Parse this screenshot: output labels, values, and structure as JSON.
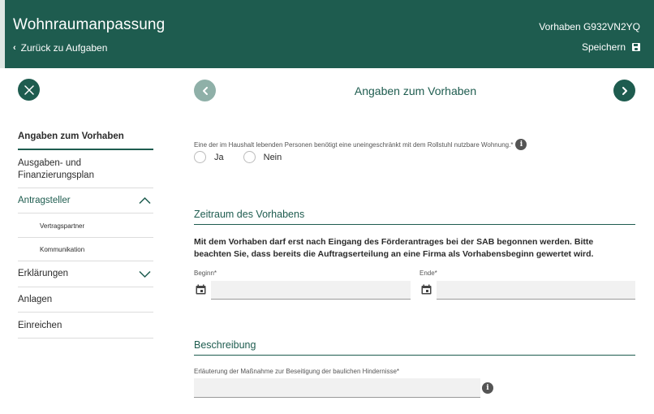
{
  "header": {
    "title": "Wohnraumanpassung",
    "back_label": "Zurück zu Aufgaben",
    "vorhaben_id": "Vorhaben G932VN2YQ",
    "save_label": "Speichern"
  },
  "colors": {
    "primary": "#1e5c4f",
    "primary_disabled": "#8fb0a8",
    "input_bg": "#f1f1f1"
  },
  "page": {
    "section_heading": "Angaben zum Vorhaben"
  },
  "nav": {
    "items": [
      {
        "label": "Angaben zum Vorhaben",
        "state": "active"
      },
      {
        "label": "Ausgaben- und Finanzierungsplan"
      },
      {
        "label": "Antragsteller",
        "state": "expanded"
      },
      {
        "label": "Vertragspartner",
        "level": "sub"
      },
      {
        "label": "Kommunikation",
        "level": "sub"
      },
      {
        "label": "Erklärungen",
        "state": "collapsed"
      },
      {
        "label": "Anlagen"
      },
      {
        "label": "Einreichen"
      }
    ]
  },
  "form": {
    "rollstuhl_question": "Eine der im Haushalt lebenden Personen benötigt eine uneingeschränkt mit dem Rollstuhl nutzbare Wohnung.*",
    "radio_yes": "Ja",
    "radio_no": "Nein",
    "zeitraum_heading": "Zeitraum des Vorhabens",
    "zeitraum_notice": "Mit dem Vorhaben darf erst nach Eingang des Förderantrages bei der SAB begonnen werden. Bitte beachten Sie, dass bereits die Auftragserteilung an eine Firma als Vorhabensbeginn gewertet wird.",
    "beginn_label": "Beginn*",
    "beginn_value": "",
    "ende_label": "Ende*",
    "ende_value": "",
    "beschreibung_heading": "Beschreibung",
    "erlaeuterung_label": "Erläuterung der Maßnahme zur Beseitigung der baulichen Hindernisse*",
    "erlaeuterung_value": ""
  },
  "icons": {
    "close": "close-icon",
    "prev": "chevron-left-icon",
    "next": "chevron-right-icon",
    "save": "save-icon",
    "info": "info-icon",
    "calendar": "calendar-icon"
  }
}
